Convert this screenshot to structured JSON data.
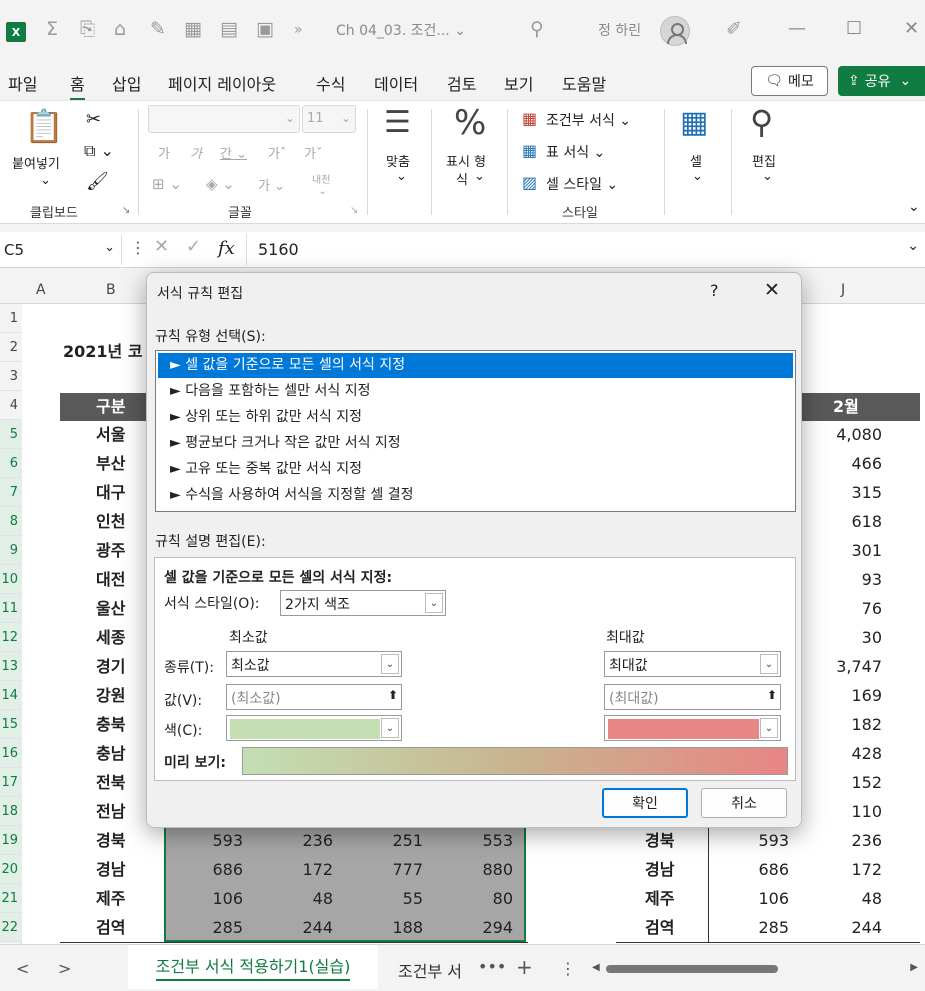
{
  "titlebar": {
    "app_icon": "X",
    "doc_title": "Ch 04_03. 조건... ⌄",
    "user_name": "정 하린"
  },
  "menu": {
    "tabs": [
      "파일",
      "홈",
      "삽입",
      "페이지 레이아웃",
      "수식",
      "데이터",
      "검토",
      "보기",
      "도움말"
    ],
    "active_tab": "홈",
    "memo_label": "메모",
    "share_label": "공유"
  },
  "ribbon": {
    "clipboard": {
      "paste_label": "붙여넣기",
      "group_label": "클립보드"
    },
    "font": {
      "size_value": "11",
      "group_label": "글꼴"
    },
    "align": {
      "label": "맞춤"
    },
    "number": {
      "label_line1": "표시 형",
      "label_line2": "식"
    },
    "styles": {
      "conditional": "조건부 서식",
      "table": "표 서식",
      "cell_style": "셀 스타일",
      "group_label": "스타일"
    },
    "cells": {
      "label": "셀"
    },
    "edit": {
      "label": "편집"
    }
  },
  "formula_bar": {
    "name_box": "C5",
    "fx": "fx",
    "value": "5160"
  },
  "grid": {
    "col_headers": [
      "A",
      "B",
      "J"
    ],
    "row_numbers": [
      "1",
      "2",
      "3",
      "4",
      "5",
      "6",
      "7",
      "8",
      "9",
      "10",
      "11",
      "12",
      "13",
      "14",
      "15",
      "16",
      "17",
      "18",
      "19",
      "20",
      "21",
      "22"
    ],
    "title": "2021년 코",
    "header_left": "구분",
    "header_right": "2월",
    "regions": [
      "서울",
      "부산",
      "대구",
      "인천",
      "광주",
      "대전",
      "울산",
      "세종",
      "경기",
      "강원",
      "충북",
      "충남",
      "전북",
      "전남",
      "경북",
      "경남",
      "제주",
      "검역"
    ],
    "right_values": [
      "4,080",
      "466",
      "315",
      "618",
      "301",
      "93",
      "76",
      "30",
      "3,747",
      "169",
      "182",
      "428",
      "152",
      "110",
      "236",
      "172",
      "48",
      "244"
    ],
    "lower_rows": [
      {
        "c": "593",
        "d": "236",
        "e": "251",
        "f": "553",
        "region": "경북",
        "i": "593"
      },
      {
        "c": "686",
        "d": "172",
        "e": "777",
        "f": "880",
        "region": "경남",
        "i": "686"
      },
      {
        "c": "106",
        "d": "48",
        "e": "55",
        "f": "80",
        "region": "제주",
        "i": "106"
      },
      {
        "c": "285",
        "d": "244",
        "e": "188",
        "f": "294",
        "region": "검역",
        "i": "285"
      }
    ]
  },
  "sheets": {
    "active": "조건부 서식 적용하기1(실습)",
    "next": "조건부 서"
  },
  "dialog": {
    "title": "서식 규칙 편집",
    "help": "?",
    "close": "✕",
    "rule_type_label": "규칙 유형 선택(S):",
    "rule_types": [
      "► 셀 값을 기준으로 모든 셀의 서식 지정",
      "► 다음을 포함하는 셀만 서식 지정",
      "► 상위 또는 하위 값만 서식 지정",
      "► 평균보다 크거나 작은 값만 서식 지정",
      "► 고유 또는 중복 값만 서식 지정",
      "► 수식을 사용하여 서식을 지정할 셀 결정"
    ],
    "desc_label": "규칙 설명 편집(E):",
    "desc_heading": "셀 값을 기준으로 모든 셀의 서식 지정:",
    "format_style_label": "서식 스타일(O):",
    "format_style_value": "2가지 색조",
    "min_heading": "최소값",
    "max_heading": "최대값",
    "type_label": "종류(T):",
    "value_label": "값(V):",
    "color_label": "색(C):",
    "min_type": "최소값",
    "max_type": "최대값",
    "min_value_placeholder": "(최소값)",
    "max_value_placeholder": "(최대값)",
    "min_color": "#c4dfb4",
    "max_color": "#e88585",
    "preview_label": "미리 보기:",
    "ok": "확인",
    "cancel": "취소"
  }
}
